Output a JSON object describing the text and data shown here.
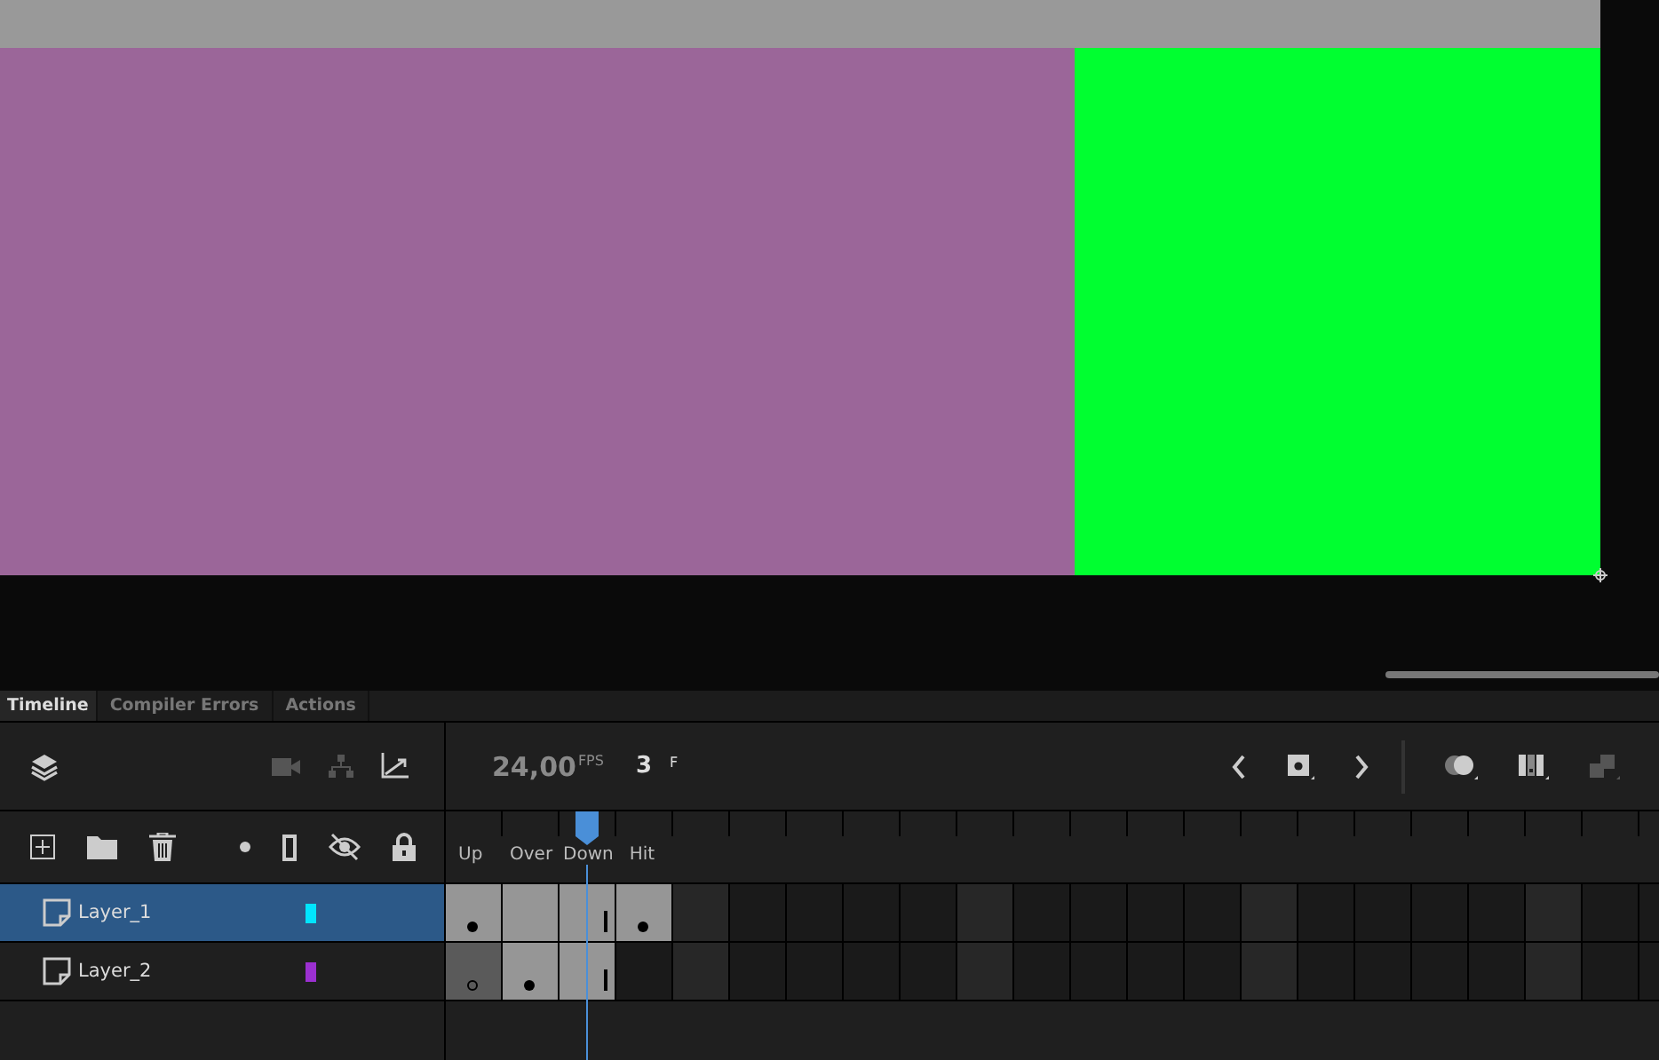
{
  "tabs": [
    {
      "label": "Timeline",
      "selected": true
    },
    {
      "label": "Compiler Errors",
      "selected": false
    },
    {
      "label": "Actions",
      "selected": false
    }
  ],
  "toolbar_left": [
    {
      "kind": "camera",
      "disabled": true
    },
    {
      "kind": "hierarchy",
      "disabled": true
    },
    {
      "kind": "graph",
      "disabled": false
    }
  ],
  "fps": "24,00",
  "fps_unit": "FPS",
  "current_frame": "3",
  "frame_unit": "F",
  "toolbar_right": [
    {
      "kind": "prev",
      "disabled": false
    },
    {
      "kind": "keyframe",
      "disabled": false
    },
    {
      "kind": "next",
      "disabled": false
    },
    {
      "kind": "onion",
      "disabled": false
    },
    {
      "kind": "multi",
      "disabled": false
    },
    {
      "kind": "paste",
      "disabled": true
    }
  ],
  "frame_labels": [
    "Up",
    "Over",
    "Down",
    "Hit"
  ],
  "layers": [
    {
      "name": "Layer_1",
      "color": "#00e5ff",
      "selected": true,
      "frames": [
        {
          "kind": "key"
        },
        {
          "kind": "span"
        },
        {
          "kind": "end"
        },
        {
          "kind": "key"
        }
      ]
    },
    {
      "name": "Layer_2",
      "color": "#9b30d0",
      "selected": false,
      "frames": [
        {
          "kind": "blank_key"
        },
        {
          "kind": "key"
        },
        {
          "kind": "end"
        }
      ]
    }
  ]
}
